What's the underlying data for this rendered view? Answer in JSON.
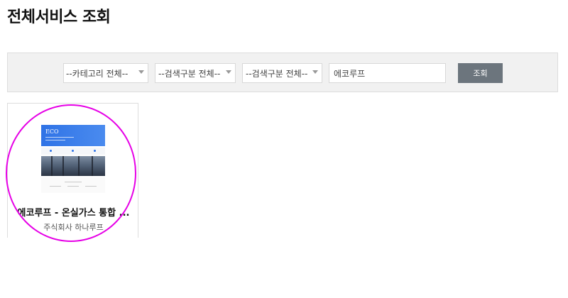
{
  "page": {
    "title": "전체서비스 조회"
  },
  "search": {
    "category_select": "--카테고리 전체--",
    "type_select_1": "--검색구분 전체--",
    "type_select_2": "--검색구분 전체--",
    "query_value": "에코루프",
    "submit_label": "조회"
  },
  "results": [
    {
      "title": "에코루프 - 온실가스 통합 ...",
      "company": "주식회사 하나루프",
      "thumbnail_logo": "ECO"
    }
  ],
  "colors": {
    "submit_button": "#6c757d",
    "thumbnail_accent": "#2f73e6",
    "highlight_ring": "#e600e6"
  }
}
